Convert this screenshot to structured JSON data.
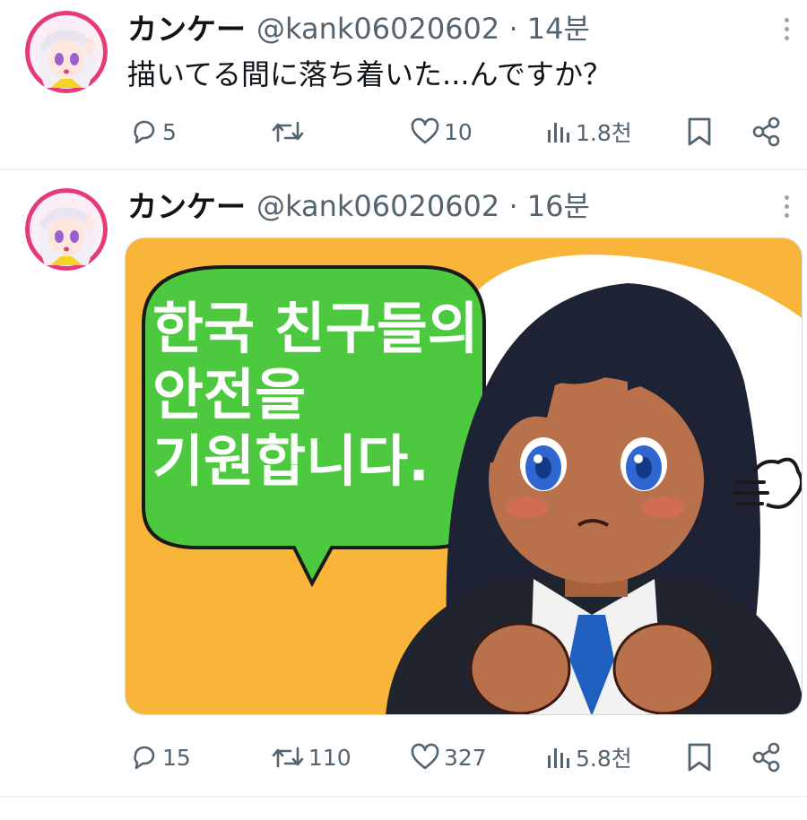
{
  "tweets": [
    {
      "display_name": "カンケー",
      "meta": "@kank06020602 · 14분",
      "text": "描いてる間に落ち着いた...んですか？",
      "stats": {
        "replies": "5",
        "retweets": "",
        "likes": "10",
        "views": "1.8천"
      }
    },
    {
      "display_name": "カンケー",
      "meta": "@kank06020602 · 16분",
      "image": {
        "bubble_lines": [
          "한국 친구들의",
          "안전을",
          "기원합니다."
        ],
        "colors": {
          "background": "#f9b43a",
          "bubble": "#4cc93e",
          "hair": "#1d2235",
          "skin": "#b8714a",
          "tie": "#1f5fbf"
        }
      },
      "stats": {
        "replies": "15",
        "retweets": "110",
        "likes": "327",
        "views": "5.8천"
      }
    }
  ],
  "icons": [
    "more-icon",
    "reply-icon",
    "retweet-icon",
    "like-icon",
    "views-icon",
    "bookmark-icon",
    "share-icon"
  ],
  "colors": {
    "text": "#0f1419",
    "secondary": "#536471",
    "divider": "#eff3f4"
  }
}
